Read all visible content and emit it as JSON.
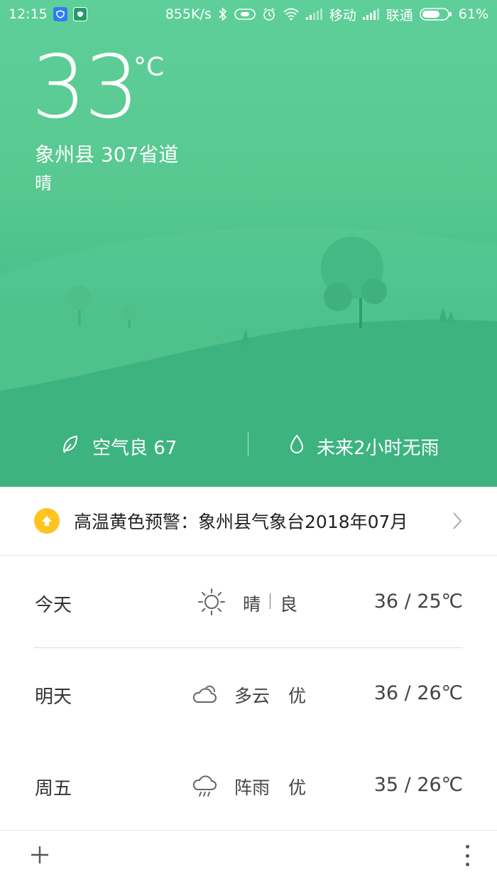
{
  "status_bar": {
    "time": "12:15",
    "speed": "855K/s",
    "carrier1": "移动",
    "carrier2": "联通",
    "battery": "61%",
    "icons": [
      "shield-app-icon",
      "security-app-icon",
      "bluetooth-icon",
      "hd-icon",
      "alarm-icon",
      "wifi-icon",
      "signal-icon",
      "signal-icon",
      "battery-icon"
    ]
  },
  "current": {
    "temperature": "33",
    "unit": "°C",
    "location": "象州县  307省道",
    "condition": "晴"
  },
  "info": {
    "aqi_label": "空气良 67",
    "rain_label": "未来2小时无雨"
  },
  "alert": {
    "text": "高温黄色预警：象州县气象台2018年07月",
    "icon": "arrow-up-icon"
  },
  "forecast": [
    {
      "day": "今天",
      "icon": "sun-icon",
      "desc": "晴",
      "quality": "良",
      "temp": "36 / 25℃"
    },
    {
      "day": "明天",
      "icon": "cloudy-icon",
      "desc": "多云",
      "quality": "优",
      "temp": "36 / 26℃"
    },
    {
      "day": "周五",
      "icon": "shower-icon",
      "desc": "阵雨",
      "quality": "优",
      "temp": "35 / 26℃"
    }
  ],
  "colors": {
    "hero_top": "#5ecf98",
    "hero_bottom": "#34b07b",
    "alert_icon": "#ffc41f",
    "text_dark": "#333333"
  }
}
